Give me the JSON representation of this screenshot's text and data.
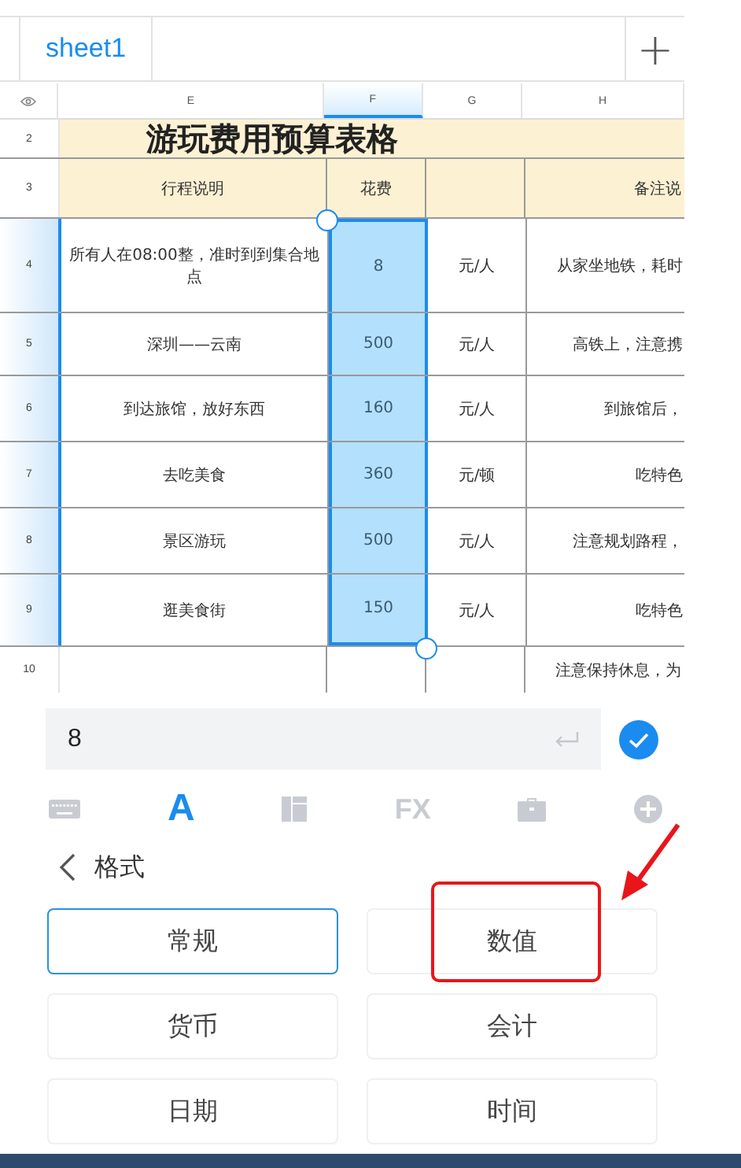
{
  "tabs": [
    {
      "label": "sheet1",
      "selected": true
    }
  ],
  "add_sheet": "+",
  "columns": [
    {
      "label": "E",
      "selected": false
    },
    {
      "label": "F",
      "selected": true
    },
    {
      "label": "G",
      "selected": false
    },
    {
      "label": "H",
      "selected": false
    }
  ],
  "rows": [
    {
      "number": "2",
      "kind": "title",
      "selected": false,
      "e": "游玩费用预算表格"
    },
    {
      "number": "3",
      "kind": "header",
      "selected": false,
      "e": "行程说明",
      "f": "花费",
      "h": "备注说"
    },
    {
      "number": "4",
      "kind": "data",
      "selected": true,
      "e": "所有人在08:00整，准时到到集合地点",
      "f": "8",
      "g": "元/人",
      "h": "从家坐地铁，耗时"
    },
    {
      "number": "5",
      "kind": "data",
      "selected": true,
      "e": "深圳——云南",
      "f": "500",
      "g": "元/人",
      "h": "高铁上，注意携"
    },
    {
      "number": "6",
      "kind": "data",
      "selected": true,
      "e": "到达旅馆，放好东西",
      "f": "160",
      "g": "元/人",
      "h": "到旅馆后，"
    },
    {
      "number": "7",
      "kind": "data",
      "selected": true,
      "e": "去吃美食",
      "f": "360",
      "g": "元/顿",
      "h": "吃特色"
    },
    {
      "number": "8",
      "kind": "data",
      "selected": true,
      "e": "景区游玩",
      "f": "500",
      "g": "元/人",
      "h": "注意规划路程，"
    },
    {
      "number": "9",
      "kind": "data",
      "selected": true,
      "e": "逛美食街",
      "f": "150",
      "g": "元/人",
      "h": "吃特色"
    },
    {
      "number": "10",
      "kind": "data",
      "selected": false,
      "h": "注意保持休息，为"
    }
  ],
  "formula_bar": {
    "value": "8"
  },
  "toolbar": [
    {
      "kind": "keyboard",
      "selected": false
    },
    {
      "kind": "font",
      "label": "A",
      "selected": true
    },
    {
      "kind": "layout",
      "selected": false
    },
    {
      "kind": "fx",
      "label": "FX",
      "selected": false
    },
    {
      "kind": "briefcase",
      "selected": false
    },
    {
      "kind": "plus",
      "selected": false
    }
  ],
  "panel": {
    "title": "格式"
  },
  "formats": [
    {
      "label": "常规",
      "selected": true,
      "highlighted": false
    },
    {
      "label": "数值",
      "selected": false,
      "highlighted": true
    },
    {
      "label": "货币",
      "selected": false,
      "highlighted": false
    },
    {
      "label": "会计",
      "selected": false,
      "highlighted": false
    },
    {
      "label": "日期",
      "selected": false,
      "highlighted": false
    },
    {
      "label": "时间",
      "selected": false,
      "highlighted": false
    }
  ]
}
